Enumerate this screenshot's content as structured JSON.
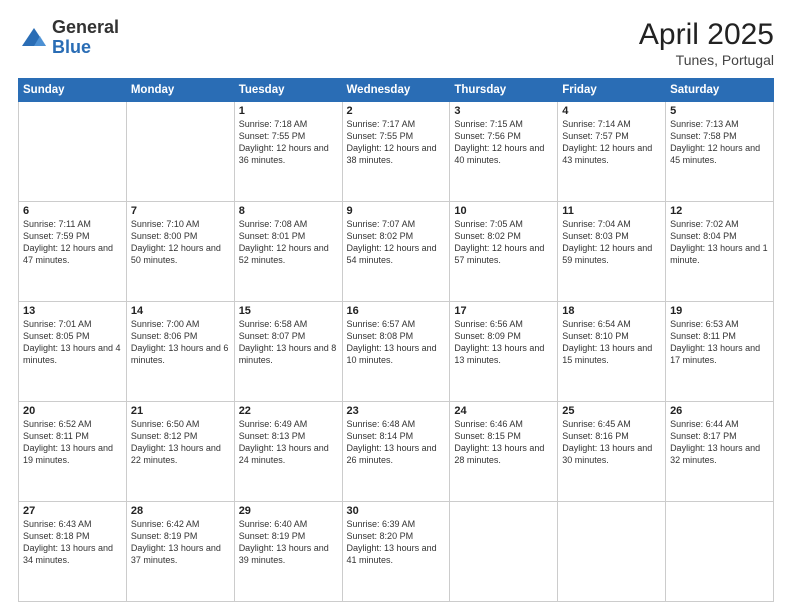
{
  "logo": {
    "general": "General",
    "blue": "Blue"
  },
  "header": {
    "month": "April 2025",
    "location": "Tunes, Portugal"
  },
  "days_of_week": [
    "Sunday",
    "Monday",
    "Tuesday",
    "Wednesday",
    "Thursday",
    "Friday",
    "Saturday"
  ],
  "weeks": [
    [
      {
        "day": "",
        "info": ""
      },
      {
        "day": "",
        "info": ""
      },
      {
        "day": "1",
        "info": "Sunrise: 7:18 AM\nSunset: 7:55 PM\nDaylight: 12 hours and 36 minutes."
      },
      {
        "day": "2",
        "info": "Sunrise: 7:17 AM\nSunset: 7:55 PM\nDaylight: 12 hours and 38 minutes."
      },
      {
        "day": "3",
        "info": "Sunrise: 7:15 AM\nSunset: 7:56 PM\nDaylight: 12 hours and 40 minutes."
      },
      {
        "day": "4",
        "info": "Sunrise: 7:14 AM\nSunset: 7:57 PM\nDaylight: 12 hours and 43 minutes."
      },
      {
        "day": "5",
        "info": "Sunrise: 7:13 AM\nSunset: 7:58 PM\nDaylight: 12 hours and 45 minutes."
      }
    ],
    [
      {
        "day": "6",
        "info": "Sunrise: 7:11 AM\nSunset: 7:59 PM\nDaylight: 12 hours and 47 minutes."
      },
      {
        "day": "7",
        "info": "Sunrise: 7:10 AM\nSunset: 8:00 PM\nDaylight: 12 hours and 50 minutes."
      },
      {
        "day": "8",
        "info": "Sunrise: 7:08 AM\nSunset: 8:01 PM\nDaylight: 12 hours and 52 minutes."
      },
      {
        "day": "9",
        "info": "Sunrise: 7:07 AM\nSunset: 8:02 PM\nDaylight: 12 hours and 54 minutes."
      },
      {
        "day": "10",
        "info": "Sunrise: 7:05 AM\nSunset: 8:02 PM\nDaylight: 12 hours and 57 minutes."
      },
      {
        "day": "11",
        "info": "Sunrise: 7:04 AM\nSunset: 8:03 PM\nDaylight: 12 hours and 59 minutes."
      },
      {
        "day": "12",
        "info": "Sunrise: 7:02 AM\nSunset: 8:04 PM\nDaylight: 13 hours and 1 minute."
      }
    ],
    [
      {
        "day": "13",
        "info": "Sunrise: 7:01 AM\nSunset: 8:05 PM\nDaylight: 13 hours and 4 minutes."
      },
      {
        "day": "14",
        "info": "Sunrise: 7:00 AM\nSunset: 8:06 PM\nDaylight: 13 hours and 6 minutes."
      },
      {
        "day": "15",
        "info": "Sunrise: 6:58 AM\nSunset: 8:07 PM\nDaylight: 13 hours and 8 minutes."
      },
      {
        "day": "16",
        "info": "Sunrise: 6:57 AM\nSunset: 8:08 PM\nDaylight: 13 hours and 10 minutes."
      },
      {
        "day": "17",
        "info": "Sunrise: 6:56 AM\nSunset: 8:09 PM\nDaylight: 13 hours and 13 minutes."
      },
      {
        "day": "18",
        "info": "Sunrise: 6:54 AM\nSunset: 8:10 PM\nDaylight: 13 hours and 15 minutes."
      },
      {
        "day": "19",
        "info": "Sunrise: 6:53 AM\nSunset: 8:11 PM\nDaylight: 13 hours and 17 minutes."
      }
    ],
    [
      {
        "day": "20",
        "info": "Sunrise: 6:52 AM\nSunset: 8:11 PM\nDaylight: 13 hours and 19 minutes."
      },
      {
        "day": "21",
        "info": "Sunrise: 6:50 AM\nSunset: 8:12 PM\nDaylight: 13 hours and 22 minutes."
      },
      {
        "day": "22",
        "info": "Sunrise: 6:49 AM\nSunset: 8:13 PM\nDaylight: 13 hours and 24 minutes."
      },
      {
        "day": "23",
        "info": "Sunrise: 6:48 AM\nSunset: 8:14 PM\nDaylight: 13 hours and 26 minutes."
      },
      {
        "day": "24",
        "info": "Sunrise: 6:46 AM\nSunset: 8:15 PM\nDaylight: 13 hours and 28 minutes."
      },
      {
        "day": "25",
        "info": "Sunrise: 6:45 AM\nSunset: 8:16 PM\nDaylight: 13 hours and 30 minutes."
      },
      {
        "day": "26",
        "info": "Sunrise: 6:44 AM\nSunset: 8:17 PM\nDaylight: 13 hours and 32 minutes."
      }
    ],
    [
      {
        "day": "27",
        "info": "Sunrise: 6:43 AM\nSunset: 8:18 PM\nDaylight: 13 hours and 34 minutes."
      },
      {
        "day": "28",
        "info": "Sunrise: 6:42 AM\nSunset: 8:19 PM\nDaylight: 13 hours and 37 minutes."
      },
      {
        "day": "29",
        "info": "Sunrise: 6:40 AM\nSunset: 8:19 PM\nDaylight: 13 hours and 39 minutes."
      },
      {
        "day": "30",
        "info": "Sunrise: 6:39 AM\nSunset: 8:20 PM\nDaylight: 13 hours and 41 minutes."
      },
      {
        "day": "",
        "info": ""
      },
      {
        "day": "",
        "info": ""
      },
      {
        "day": "",
        "info": ""
      }
    ]
  ]
}
